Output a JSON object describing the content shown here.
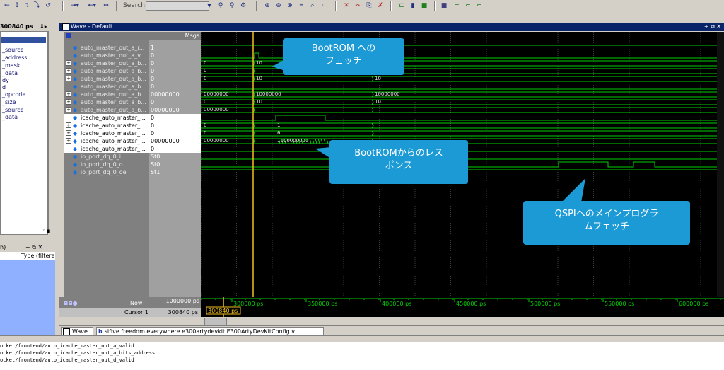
{
  "toolbar": {
    "search_label": "Search:"
  },
  "left_panel": {
    "time_field": "300840 ps",
    "items": [
      "_source",
      "_address",
      "_mask",
      "_data",
      "dy",
      "d",
      "_opcode",
      "_size",
      "_source",
      "_data"
    ],
    "lower_label": "Type (filtere"
  },
  "wave_window": {
    "title": "Wave - Default",
    "msgs_header": "Msgs"
  },
  "signals": [
    {
      "name": "auto_master_out_a_r...",
      "value": "1",
      "style": "gray",
      "expand": false
    },
    {
      "name": "auto_master_out_a_v...",
      "value": "0",
      "style": "gray",
      "expand": false
    },
    {
      "name": "auto_master_out_a_b...",
      "value": "0",
      "style": "gray",
      "expand": true
    },
    {
      "name": "auto_master_out_a_b...",
      "value": "0",
      "style": "gray",
      "expand": true
    },
    {
      "name": "auto_master_out_a_b...",
      "value": "0",
      "style": "gray",
      "expand": true
    },
    {
      "name": "auto_master_out_a_b...",
      "value": "0",
      "style": "gray",
      "expand": false
    },
    {
      "name": "auto_master_out_a_b...",
      "value": "00000000",
      "style": "gray",
      "expand": true
    },
    {
      "name": "auto_master_out_a_b...",
      "value": "0",
      "style": "gray",
      "expand": true
    },
    {
      "name": "auto_master_out_a_b...",
      "value": "00000000",
      "style": "gray",
      "expand": true
    },
    {
      "name": "icache_auto_master_...",
      "value": "0",
      "style": "white",
      "expand": false
    },
    {
      "name": "icache_auto_master_...",
      "value": "0",
      "style": "white",
      "expand": true
    },
    {
      "name": "icache_auto_master_...",
      "value": "0",
      "style": "white",
      "expand": true
    },
    {
      "name": "icache_auto_master_...",
      "value": "00000000",
      "style": "white",
      "expand": true
    },
    {
      "name": "icache_auto_master_...",
      "value": "0",
      "style": "white",
      "expand": false
    },
    {
      "name": "io_port_dq_0_i",
      "value": "St0",
      "style": "gray",
      "expand": false
    },
    {
      "name": "io_port_dq_0_o",
      "value": "St0",
      "style": "gray",
      "expand": false
    },
    {
      "name": "io_port_dq_0_oe",
      "value": "St1",
      "style": "gray",
      "expand": false
    }
  ],
  "bus_labels": [
    {
      "text": "0"
    },
    {
      "text": "0"
    },
    {
      "text": "0"
    },
    {
      "text": "00000000"
    },
    {
      "text": "0"
    },
    {
      "text": "00000000"
    },
    {
      "text": "0"
    },
    {
      "text": "0"
    },
    {
      "text": "00000000"
    },
    {
      "text": "10"
    },
    {
      "text": "10"
    },
    {
      "text": "10000000"
    },
    {
      "text": "10"
    },
    {
      "text": "10"
    },
    {
      "text": "10000000"
    },
    {
      "text": "10"
    },
    {
      "text": "1"
    },
    {
      "text": "6"
    },
    {
      "text": "1000000000"
    }
  ],
  "time_ruler": {
    "ticks": [
      "300000 ps",
      "350000 ps",
      "400000 ps",
      "450000 ps",
      "500000 ps",
      "550000 ps",
      "600000 ps"
    ],
    "cursor_value": "300840 ps"
  },
  "footer": {
    "now_label": "Now",
    "now_value": "1000000 ps",
    "cursor_label": "Cursor 1",
    "cursor_value": "300840 ps"
  },
  "callouts": {
    "bootrom_fetch": "BootROM へのフェッチ",
    "bootrom_response": "BootROMからのレスポンス",
    "qspi_fetch": "QSPIへのメインプログラムフェッチ"
  },
  "tabs": {
    "wave": "Wave",
    "file": "sifive.freedom.everywhere.e300artydevkit.E300ArtyDevKitConfig.v"
  },
  "console": {
    "lines": [
      "ocket/frontend/auto_icache_master_out_a_valid",
      "ocket/frontend/auto_icache_master_out_a_bits_address",
      "ocket/frontend/auto_icache_master_out_d_valid"
    ]
  },
  "colors": {
    "wave_green": "#00d000",
    "cursor_yellow": "#f0c020",
    "callout_blue": "#1c9ad6",
    "title_blue": "#0a246a"
  }
}
